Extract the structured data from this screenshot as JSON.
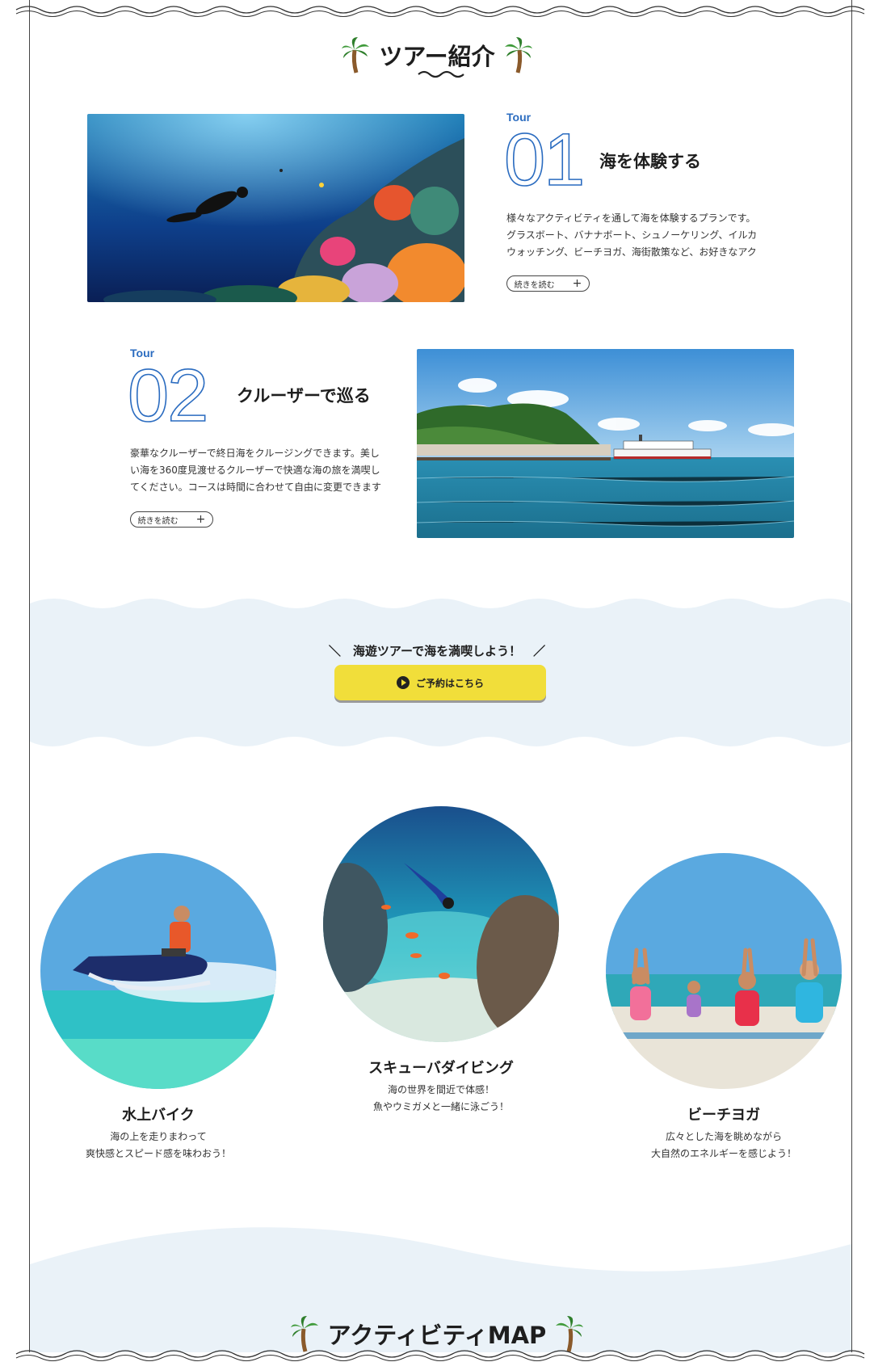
{
  "section_title": "ツアー紹介",
  "tours": [
    {
      "label": "Tour",
      "number": "01",
      "heading": "海を体験する",
      "description": "様々なアクティビティを通して海を体験するプランです。グラスボート、バナナボート、シュノーケリング、イルカウォッチング、ビーチヨガ、海街散策など、お好きなアク",
      "button": "続きを読む",
      "button_icon": "plus-icon"
    },
    {
      "label": "Tour",
      "number": "02",
      "heading": "クルーザーで巡る",
      "description": "豪華なクルーザーで終日海をクルージングできます。美しい海を360度見渡せるクルーザーで快適な海の旅を満喫してください。コースは時間に合わせて自由に変更できます",
      "button": "続きを読む",
      "button_icon": "plus-icon"
    }
  ],
  "cta": {
    "lead": "＼　海遊ツアーで海を満喫しよう！　／",
    "button": "ご予約はこちら",
    "button_color": "#f1de3a"
  },
  "activities": [
    {
      "title": "水上バイク",
      "line1": "海の上を走りまわって",
      "line2": "爽快感とスピード感を味わおう！"
    },
    {
      "title": "スキューバダイビング",
      "line1": "海の世界を間近で体感！",
      "line2": "魚やウミガメと一緒に泳ごう！"
    },
    {
      "title": "ビーチヨガ",
      "line1": "広々とした海を眺めながら",
      "line2": "大自然のエネルギーを感じよう！"
    }
  ],
  "map_title": "アクティビティMAP",
  "colors": {
    "accent_blue": "#2b6cc0",
    "band_bg": "#eaf2f8",
    "cta_yellow": "#f1de3a"
  }
}
